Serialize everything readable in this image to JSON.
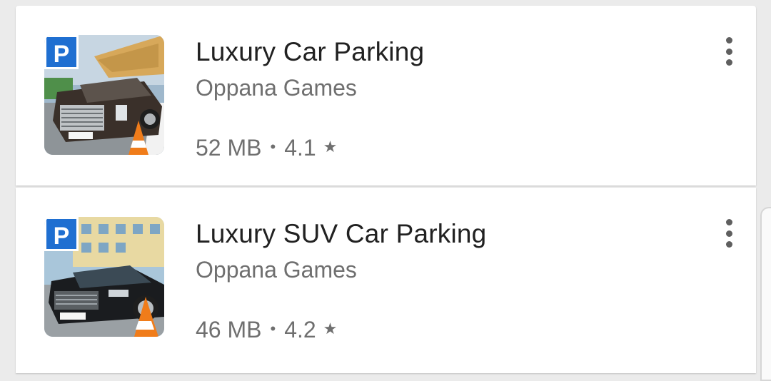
{
  "apps": [
    {
      "title": "Luxury Car Parking",
      "developer": "Oppana Games",
      "size": "52 MB",
      "separator": "•",
      "rating": "4.1",
      "rating_icon": "star-icon",
      "thumbnail": {
        "badge": "P",
        "car_color": "#3a302a"
      }
    },
    {
      "title": "Luxury SUV Car Parking",
      "developer": "Oppana Games",
      "size": "46 MB",
      "separator": "•",
      "rating": "4.2",
      "rating_icon": "star-icon",
      "thumbnail": {
        "badge": "P",
        "car_color": "#1a1c1f"
      }
    }
  ],
  "colors": {
    "title": "#212121",
    "secondary": "#6f6f6f",
    "badge_blue": "#1f6fd1",
    "cone_orange": "#f07c1a"
  }
}
